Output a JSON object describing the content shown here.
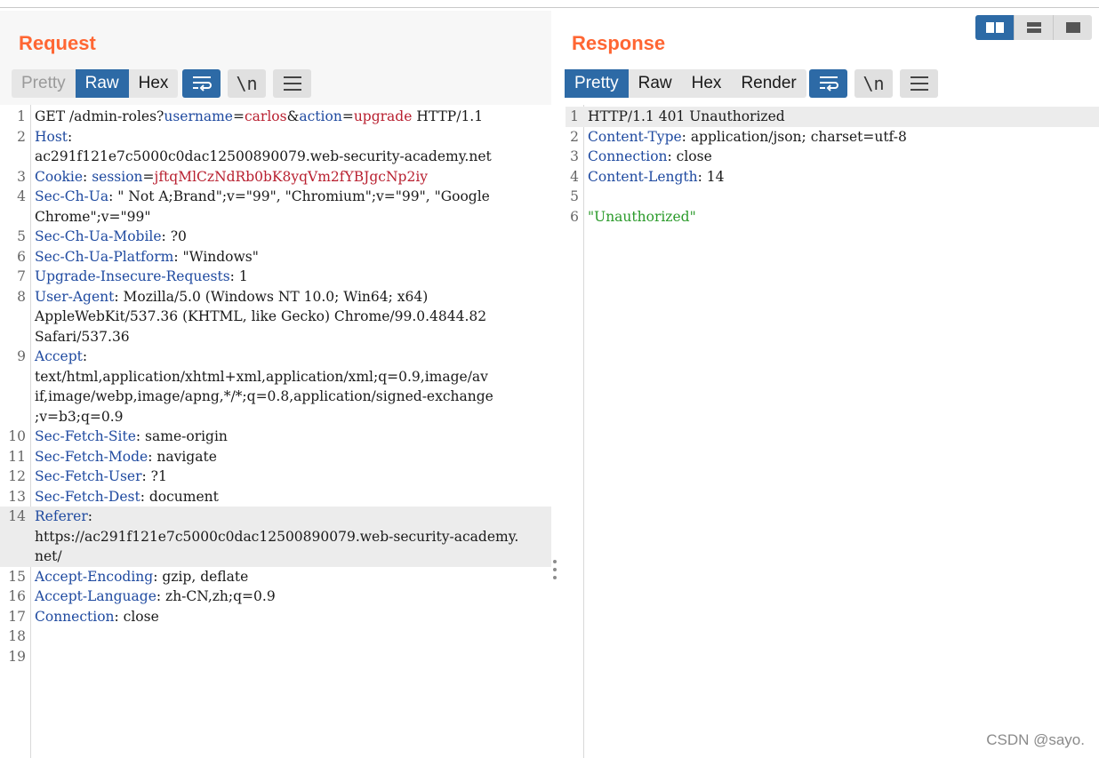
{
  "request": {
    "title": "Request",
    "tabs": [
      "Pretty",
      "Raw",
      "Hex"
    ],
    "active_tab": "Raw",
    "icons": [
      "wrap-icon",
      "newline-icon",
      "menu-icon"
    ],
    "lines": [
      {
        "n": "1",
        "t": "GET /admin-roles?username=carlos&action=upgrade HTTP/1.1"
      },
      {
        "n": "2",
        "t": "Host:\nac291f121e7c5000c0dac12500890079.web-security-academy.net"
      },
      {
        "n": "3",
        "t": "Cookie: session=jftqMlCzNdRb0bK8yqVm2fYBJgcNp2iy"
      },
      {
        "n": "4",
        "t": "Sec-Ch-Ua: \" Not A;Brand\";v=\"99\", \"Chromium\";v=\"99\", \"Google\nChrome\";v=\"99\""
      },
      {
        "n": "5",
        "t": "Sec-Ch-Ua-Mobile: ?0"
      },
      {
        "n": "6",
        "t": "Sec-Ch-Ua-Platform: \"Windows\""
      },
      {
        "n": "7",
        "t": "Upgrade-Insecure-Requests: 1"
      },
      {
        "n": "8",
        "t": "User-Agent: Mozilla/5.0 (Windows NT 10.0; Win64; x64)\nAppleWebKit/537.36 (KHTML, like Gecko) Chrome/99.0.4844.82\nSafari/537.36"
      },
      {
        "n": "9",
        "t": "Accept:\ntext/html,application/xhtml+xml,application/xml;q=0.9,image/av\nif,image/webp,image/apng,*/*;q=0.8,application/signed-exchange\n;v=b3;q=0.9"
      },
      {
        "n": "10",
        "t": "Sec-Fetch-Site: same-origin"
      },
      {
        "n": "11",
        "t": "Sec-Fetch-Mode: navigate"
      },
      {
        "n": "12",
        "t": "Sec-Fetch-User: ?1"
      },
      {
        "n": "13",
        "t": "Sec-Fetch-Dest: document"
      },
      {
        "n": "14",
        "t": "Referer:\nhttps://ac291f121e7c5000c0dac12500890079.web-security-academy.\nnet/"
      },
      {
        "n": "15",
        "t": "Accept-Encoding: gzip, deflate"
      },
      {
        "n": "16",
        "t": "Accept-Language: zh-CN,zh;q=0.9"
      },
      {
        "n": "17",
        "t": "Connection: close"
      },
      {
        "n": "18",
        "t": ""
      },
      {
        "n": "19",
        "t": ""
      }
    ]
  },
  "response": {
    "title": "Response",
    "tabs": [
      "Pretty",
      "Raw",
      "Hex",
      "Render"
    ],
    "active_tab": "Pretty",
    "icons": [
      "wrap-icon",
      "newline-icon",
      "menu-icon"
    ],
    "lines": [
      {
        "n": "1",
        "t": "HTTP/1.1 401 Unauthorized"
      },
      {
        "n": "2",
        "t": "Content-Type: application/json; charset=utf-8"
      },
      {
        "n": "3",
        "t": "Connection: close"
      },
      {
        "n": "4",
        "t": "Content-Length: 14"
      },
      {
        "n": "5",
        "t": ""
      },
      {
        "n": "6",
        "t": "\"Unauthorized\""
      }
    ]
  },
  "newline_label": "\\n",
  "layout_icons": [
    "side-by-side-icon",
    "stacked-icon",
    "single-pane-icon"
  ],
  "watermark": "CSDN @sayo.",
  "colors": {
    "accent": "#ff6633",
    "active": "#2d6aa6",
    "header_name": "#1f4aa0",
    "param_value": "#b81f2f",
    "json_string": "#2a9a2a"
  }
}
